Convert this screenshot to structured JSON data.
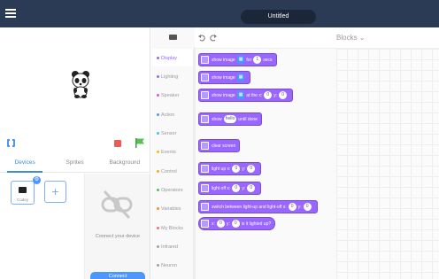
{
  "app": {
    "title": "Untitled"
  },
  "left": {
    "tabs": [
      "Devices",
      "Sprites",
      "Background"
    ],
    "device": {
      "name": "Codey"
    },
    "connect_text": "Connect your device",
    "connect_button": "Connect"
  },
  "categories": [
    {
      "label": "Display",
      "color": "#9966ff"
    },
    {
      "label": "Lighting",
      "color": "#9966ff"
    },
    {
      "label": "Speaker",
      "color": "#d65cd6"
    },
    {
      "label": "Action",
      "color": "#4c97ff"
    },
    {
      "label": "Sensor",
      "color": "#4cbfe6"
    },
    {
      "label": "Events",
      "color": "#ffbf00"
    },
    {
      "label": "Control",
      "color": "#ffab19"
    },
    {
      "label": "Operators",
      "color": "#59c059"
    },
    {
      "label": "Variables",
      "color": "#ff8c1a"
    },
    {
      "label": "My Blocks",
      "color": "#ff6680"
    },
    {
      "label": "Infrared",
      "color": "#a0a0a0"
    },
    {
      "label": "Neuron",
      "color": "#a0a0a0"
    }
  ],
  "script_header": {
    "blocks_label": "Blocks"
  },
  "blocks": [
    {
      "pre": "show image",
      "s1": "▦",
      "mid": "for",
      "s2": "1",
      "post": "secs"
    },
    {
      "pre": "show image",
      "s1": "▦"
    },
    {
      "pre": "show image",
      "s1": "▦",
      "mid": "at the x:",
      "s2": "0",
      "post": "y:",
      "s3": "0"
    },
    {
      "pre": "show",
      "s1": "hello",
      "post": "until done"
    },
    {
      "pre": "clear screen"
    },
    {
      "pre": "light up x:",
      "s1": "0",
      "mid": "y:",
      "s2": "0"
    },
    {
      "pre": "light off x:",
      "s1": "0",
      "mid": "y:",
      "s2": "0"
    },
    {
      "pre": "switch between light-up and light-off x:",
      "s1": "0",
      "mid": "y:",
      "s2": "0"
    },
    {
      "pre": "x:",
      "s1": "0",
      "mid": "y:",
      "s2": "0",
      "post": "is it lighted up?"
    }
  ]
}
